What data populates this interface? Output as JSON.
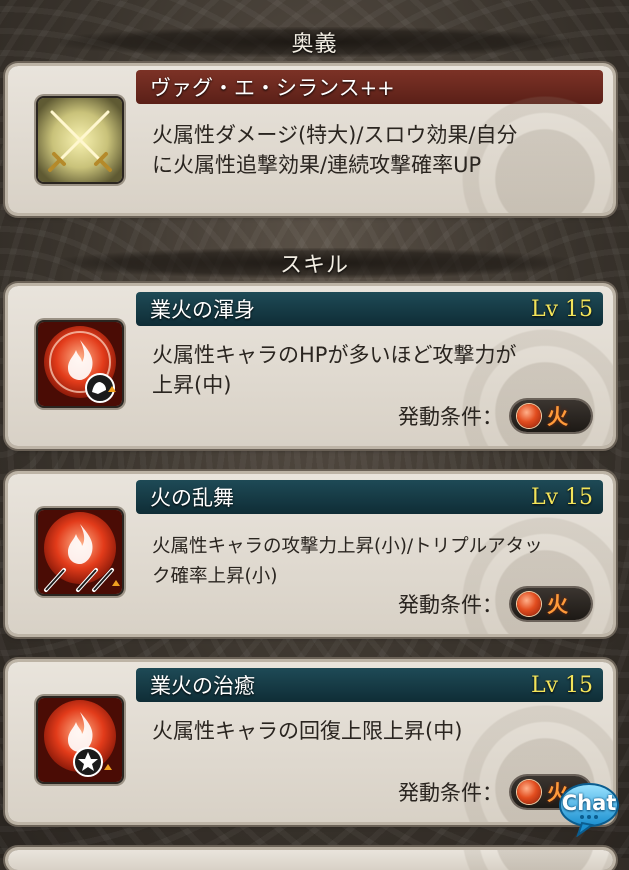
{
  "ougi_section": {
    "header": "奥義"
  },
  "ougi": {
    "name": "ヴァグ・エ・シランス++",
    "description_line1": "火属性ダメージ(特大)/スロウ効果/自分",
    "description_line2": "に火属性追撃効果/連続攻撃確率UP",
    "icon": "crossed-swords-icon"
  },
  "skill_section": {
    "header": "スキル"
  },
  "skills": [
    {
      "name": "業火の渾身",
      "level": "Lv 15",
      "description_line1": "火属性キャラのHPが多いほど攻撃力が",
      "description_line2": "上昇(中)",
      "condition_label": "発動条件：",
      "element": "火",
      "icon": "fire-might-icon"
    },
    {
      "name": "火の乱舞",
      "level": "Lv 15",
      "description_line1": "火属性キャラの攻撃力上昇(小)/トリプルアタッ",
      "description_line2": "ク確率上昇(小)",
      "condition_label": "発動条件：",
      "element": "火",
      "icon": "fire-triple-attack-icon"
    },
    {
      "name": "業火の治癒",
      "level": "Lv 15",
      "description_line1": "火属性キャラの回復上限上昇(中)",
      "description_line2": "",
      "condition_label": "発動条件：",
      "element": "火",
      "icon": "fire-heal-cap-icon"
    }
  ],
  "chat_button": {
    "label": "Chat"
  },
  "colors": {
    "ougi_title_bar": "#6a281e",
    "skill_title_bar": "#163a44",
    "level_text": "#f3e45a",
    "fire": "#e24d1f"
  }
}
